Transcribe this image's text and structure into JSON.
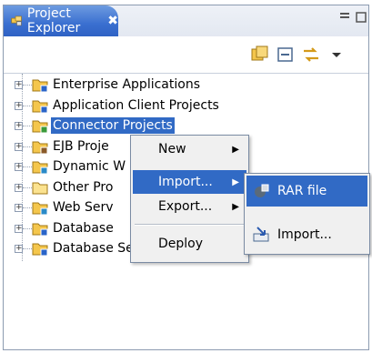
{
  "view": {
    "title": "Project Explorer",
    "close_glyph": "✖"
  },
  "toolbar": {
    "icons": [
      "collapse-all-icon",
      "link-with-editor-icon",
      "sync-icon",
      "view-menu-icon"
    ]
  },
  "tree": {
    "items": [
      {
        "label": "Enterprise Applications",
        "icon": "enterprise-app-folder-icon"
      },
      {
        "label": "Application Client Projects",
        "icon": "app-client-folder-icon"
      },
      {
        "label": "Connector Projects",
        "icon": "connector-folder-icon",
        "selected": true
      },
      {
        "label": "EJB Proje",
        "icon": "ejb-folder-icon"
      },
      {
        "label": "Dynamic W",
        "icon": "dynamic-web-folder-icon"
      },
      {
        "label": "Other Pro",
        "icon": "folder-icon"
      },
      {
        "label": "Web Serv",
        "icon": "web-services-folder-icon"
      },
      {
        "label": "Database",
        "icon": "database-folder-icon"
      },
      {
        "label": "Database Servers",
        "icon": "database-servers-folder-icon"
      }
    ]
  },
  "context_menu": {
    "items": [
      {
        "label": "New",
        "submenu": true
      },
      {
        "label": "Import...",
        "submenu": true,
        "highlighted": true
      },
      {
        "label": "Export...",
        "submenu": true
      },
      {
        "label": "Deploy",
        "submenu": false
      }
    ]
  },
  "import_submenu": {
    "items": [
      {
        "label": "RAR file",
        "icon": "rar-file-icon",
        "highlighted": true
      },
      {
        "label": "Import...",
        "icon": "import-wizard-icon"
      }
    ]
  },
  "colors": {
    "selection": "#316ac5",
    "tab_active": "#3a6fd0",
    "menu_bg": "#f0f0f0"
  }
}
